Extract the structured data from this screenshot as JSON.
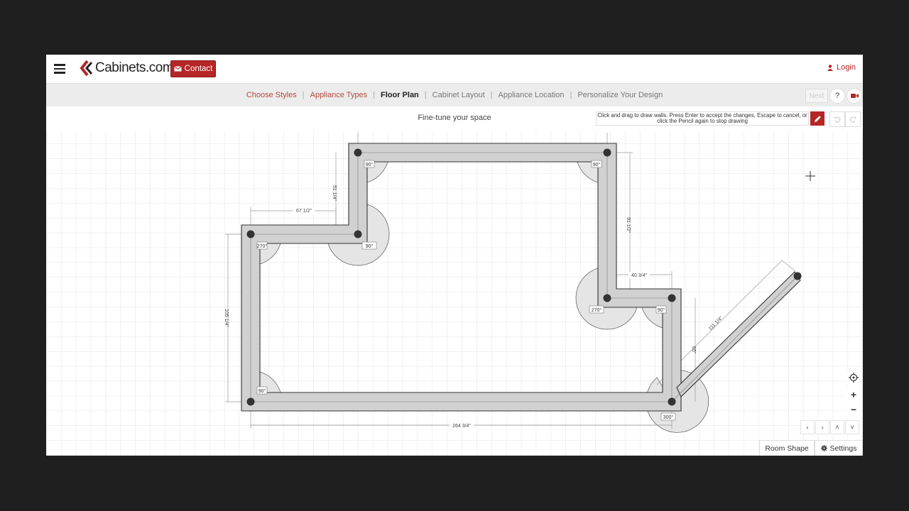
{
  "header": {
    "menu_icon": "hamburger-icon",
    "logo_text": "Cabinets.com",
    "logo_mark": "®",
    "contact_label": "Contact",
    "contact_icon": "envelope-icon",
    "login_label": "Login",
    "login_icon": "user-icon"
  },
  "steps": [
    {
      "label": "Choose Styles",
      "state": "done"
    },
    {
      "label": "Appliance Types",
      "state": "done"
    },
    {
      "label": "Floor Plan",
      "state": "active"
    },
    {
      "label": "Cabinet Layout",
      "state": "todo"
    },
    {
      "label": "Appliance Location",
      "state": "todo"
    },
    {
      "label": "Personalize Your Design",
      "state": "todo"
    }
  ],
  "step_separator": "|",
  "nav_buttons": {
    "next": "Next",
    "help": "?",
    "video_icon": "video-camera-icon"
  },
  "toolbar": {
    "subtitle": "Fine-tune your space",
    "hint": "Click and drag to draw walls. Press Enter to accept the changes, Escape to cancel, or click the Pencil again to stop drawing",
    "pencil_icon": "pencil-icon",
    "undo_icon": "undo-icon",
    "redo_icon": "redo-icon"
  },
  "plan": {
    "dimensions": [
      "67 1/2\"",
      "51 1/4\"",
      "105 1/4\"",
      "91 1/2\"",
      "40 3/4\"",
      "65\"",
      "111 1/4\"",
      "264 3/4\""
    ],
    "angles": [
      "90°",
      "90°",
      "270°",
      "90°",
      "270°",
      "90°",
      "90°",
      "300°"
    ]
  },
  "controls": {
    "locate_icon": "crosshair-icon",
    "zoom_in": "+",
    "zoom_out": "−",
    "pan_left": "‹",
    "pan_right": "›",
    "pan_up": "˄",
    "pan_down": "˅"
  },
  "bottom": {
    "room_shape": "Room Shape",
    "settings": "Settings",
    "settings_icon": "gear-icon"
  },
  "colors": {
    "brand": "#b52626",
    "wall": "#d0d0d0",
    "grid": "#dddddd"
  }
}
